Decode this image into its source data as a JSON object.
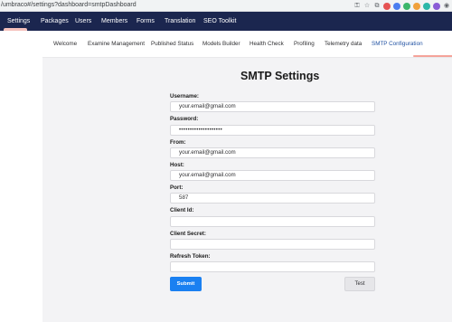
{
  "browser": {
    "url": "/umbraco#/settings?dashboard=smtpDashboard",
    "icons": [
      "key-icon",
      "star-icon",
      "extensions-icon",
      "profile-icon"
    ]
  },
  "topnav": {
    "items": [
      "Settings",
      "Packages",
      "Users",
      "Members",
      "Forms",
      "Translation",
      "SEO Toolkit"
    ],
    "active": "Settings"
  },
  "subnav": {
    "tabs": [
      "Welcome",
      "Examine Management",
      "Published Status",
      "Models Builder",
      "Health Check",
      "Profiling",
      "Telemetry data",
      "SMTP Configuration"
    ],
    "active": "SMTP Configuration"
  },
  "form": {
    "title": "SMTP Settings",
    "username_label": "Username:",
    "username_value": "your.email@gmail.com",
    "password_label": "Password:",
    "password_value": "••••••••••••••••••••",
    "from_label": "From:",
    "from_value": "your.email@gmail.com",
    "host_label": "Host:",
    "host_value": "your.email@gmail.com",
    "port_label": "Port:",
    "port_value": "587",
    "client_id_label": "Client Id:",
    "client_id_value": "",
    "client_secret_label": "Client Secret:",
    "client_secret_value": "",
    "refresh_token_label": "Refresh Token:",
    "refresh_token_value": "",
    "submit_label": "Submit",
    "test_label": "Test"
  },
  "colors": {
    "topnav_bg": "#1b264f",
    "submit_bg": "#1a80f1",
    "active_tab_text": "#2152a3",
    "active_underline": "#f5a39a"
  }
}
